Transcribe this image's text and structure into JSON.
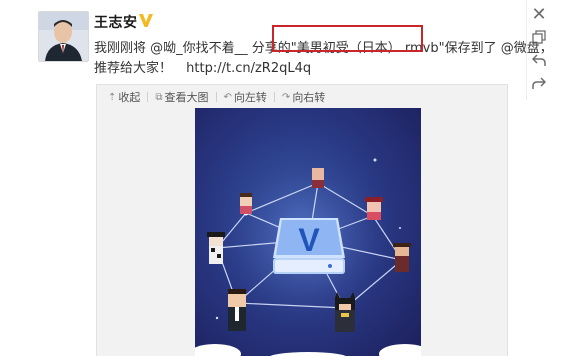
{
  "post": {
    "username": "王志安",
    "text_line1": "我刚刚将 @呦_你找不着__ 分享的\"美男初受（日本）.rmvb\"保存到了 @微盘，",
    "text_line2_prefix": "推荐给大家！",
    "link": "http://t.cn/zR2qL4q"
  },
  "media_toolbar": {
    "collapse": "收起",
    "view_large": "查看大图",
    "rotate_left": "向左转",
    "rotate_right": "向右转"
  },
  "picture": {
    "center_logo_letter": "V"
  },
  "icons": {
    "verified": "verified-v-badge-icon",
    "close": "close-icon",
    "window": "popout-window-icon",
    "back": "back-arrow-icon",
    "forward": "forward-arrow-icon"
  },
  "colors": {
    "highlight_box": "#c9252b",
    "verified_badge": "#f5b820",
    "picture_bg": "#2a3a86"
  }
}
